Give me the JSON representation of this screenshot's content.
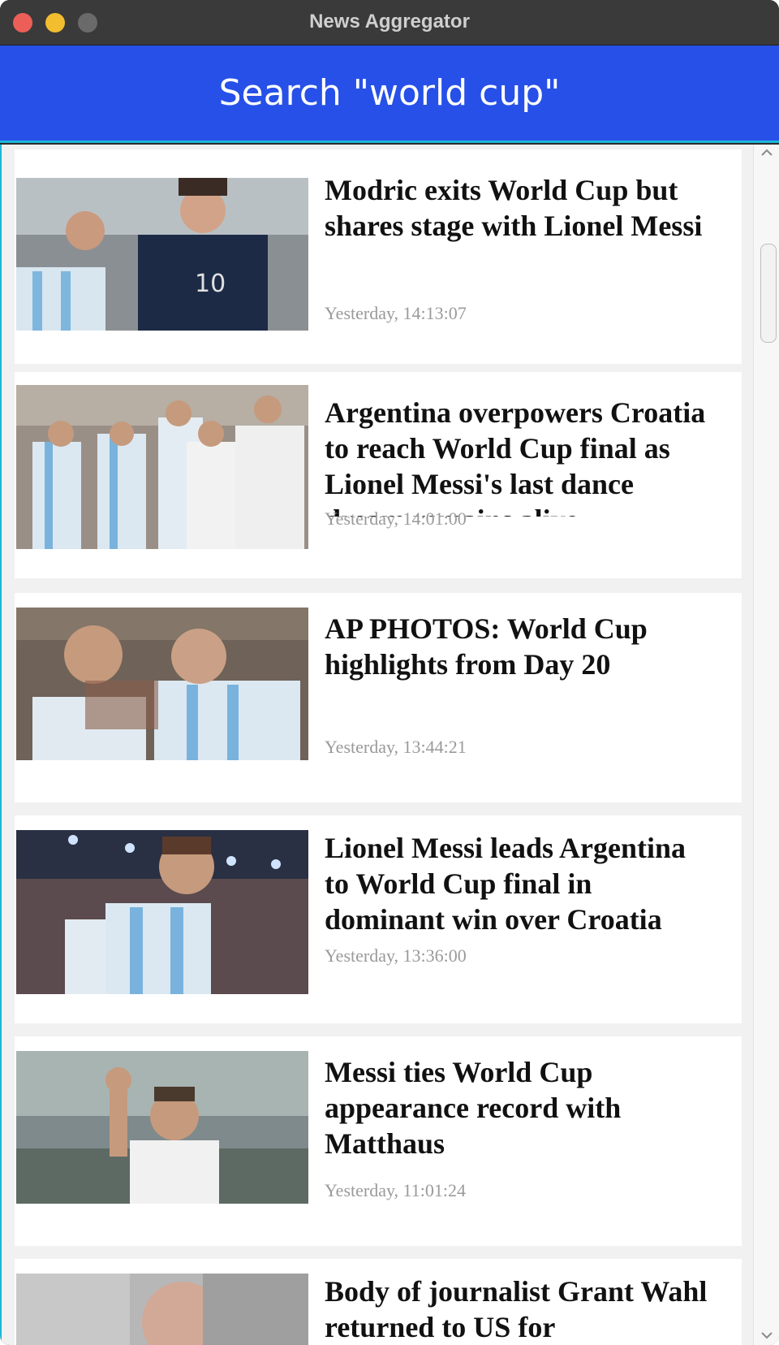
{
  "window": {
    "title": "News Aggregator"
  },
  "header": {
    "title": "Search \"world cup\""
  },
  "articles": [
    {
      "headline": "Modric exits World Cup but shares stage with Lionel Messi",
      "timestamp": "Yesterday, 14:13:07"
    },
    {
      "headline": "Argentina overpowers Croatia to reach World Cup final as Lionel Messi's last dance dream remains alive",
      "timestamp": "Yesterday, 14:01:00"
    },
    {
      "headline": "AP PHOTOS: World Cup highlights from Day 20",
      "timestamp": "Yesterday, 13:44:21"
    },
    {
      "headline": "Lionel Messi leads Argentina to World Cup final in dominant win over Croatia",
      "timestamp": "Yesterday, 13:36:00"
    },
    {
      "headline": "Messi ties World Cup appearance record with Matthaus",
      "timestamp": "Yesterday, 11:01:24"
    },
    {
      "headline": "Body of journalist Grant Wahl returned to US for",
      "timestamp": ""
    }
  ],
  "colors": {
    "header_bg": "#2650e8",
    "accent_border": "#1db6d8",
    "timestamp": "#9a9a9a"
  },
  "icons": {
    "scroll_up": "chevron-up-icon",
    "scroll_down": "chevron-down-icon"
  }
}
